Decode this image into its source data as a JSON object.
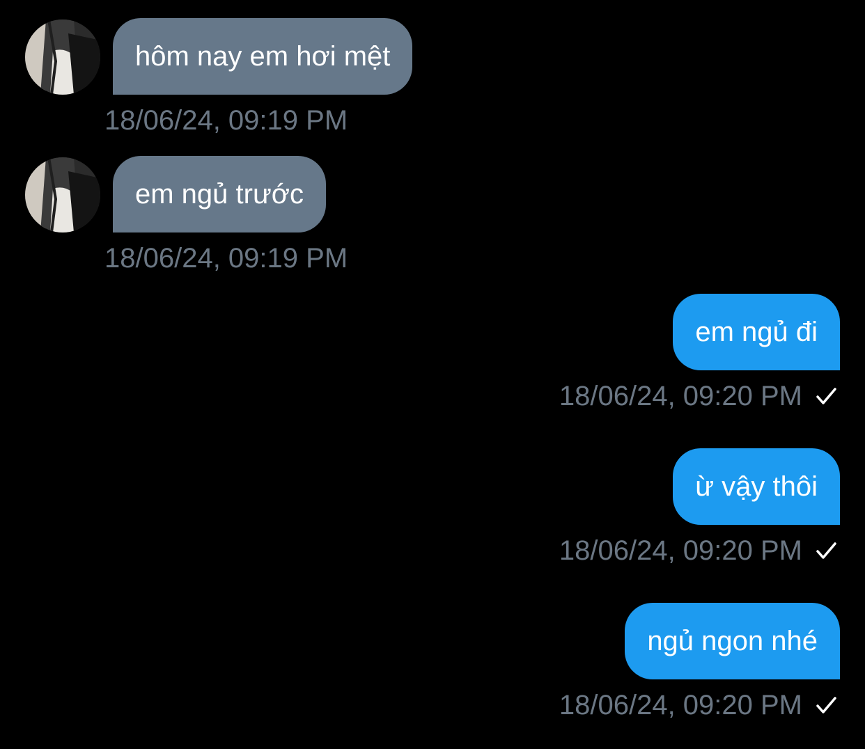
{
  "messages": [
    {
      "direction": "incoming",
      "text": "hôm nay em hơi mệt",
      "time": "18/06/24, 09:19 PM",
      "avatar_icon": "user-avatar"
    },
    {
      "direction": "incoming",
      "text": "em ngủ trước",
      "time": "18/06/24, 09:19 PM",
      "avatar_icon": "user-avatar"
    },
    {
      "direction": "outgoing",
      "text": "em ngủ đi",
      "time": "18/06/24, 09:20 PM",
      "status_icon": "checkmark-icon"
    },
    {
      "direction": "outgoing",
      "text": "ừ vậy thôi",
      "time": "18/06/24, 09:20 PM",
      "status_icon": "checkmark-icon"
    },
    {
      "direction": "outgoing",
      "text": "ngủ ngon nhé",
      "time": "18/06/24, 09:20 PM",
      "status_icon": "checkmark-icon"
    }
  ],
  "colors": {
    "background": "#000000",
    "incoming_bubble": "#66788a",
    "outgoing_bubble": "#1d9bf0",
    "timestamp": "#6b7784",
    "text": "#ffffff"
  }
}
